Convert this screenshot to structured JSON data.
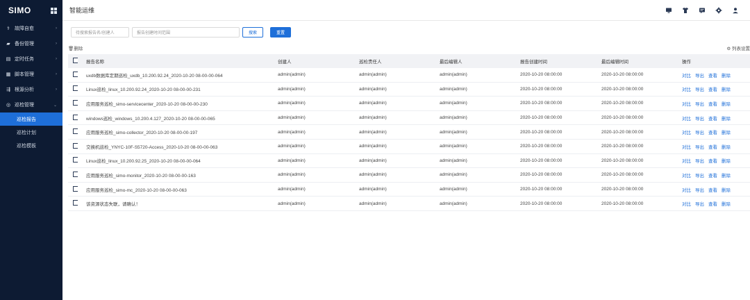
{
  "sidebar": {
    "logo": "SIMO",
    "menu": [
      {
        "label": "故障自愈",
        "icon": "fault-heal-icon",
        "glyph": "⚕"
      },
      {
        "label": "备份管理",
        "icon": "folder-icon",
        "glyph": "▰"
      },
      {
        "label": "定时任务",
        "icon": "schedule-icon",
        "glyph": "▤"
      },
      {
        "label": "脚本管理",
        "icon": "script-icon",
        "glyph": "▦"
      },
      {
        "label": "根源分析",
        "icon": "root-cause-icon",
        "glyph": "⇶"
      },
      {
        "label": "巡检管理",
        "icon": "inspection-icon",
        "glyph": "◎"
      }
    ],
    "submenu": [
      {
        "label": "巡检报告",
        "active": true
      },
      {
        "label": "巡检计划",
        "active": false
      },
      {
        "label": "巡检模板",
        "active": false
      }
    ]
  },
  "header": {
    "title": "智能运维"
  },
  "search": {
    "name_placeholder": "待搜索报告名/创建人",
    "date_placeholder": "报告创建时间范围",
    "search_label": "搜索",
    "reset_label": "重置"
  },
  "toolbar": {
    "delete_label": "删除",
    "columns_label": "列表设置"
  },
  "table": {
    "headers": [
      "报告名称",
      "创建人",
      "巡检责任人",
      "最后编辑人",
      "报告创建时间",
      "最后编辑时间",
      "操作"
    ],
    "ops": [
      "对比",
      "导出",
      "查看",
      "删除"
    ],
    "rows": [
      {
        "name": "uxdb数据库定期巡检_uxdb_10.200.92.24_2020-10-20 08-00-00-064",
        "creator": "admin(admin)",
        "owner": "admin(admin)",
        "editor": "admin(admin)",
        "created": "2020-10-20 08:00:00",
        "edited": "2020-10-20 08:00:00"
      },
      {
        "name": "Linux巡检_linux_10.200.92.24_2020-10-20 08-00-00-231",
        "creator": "admin(admin)",
        "owner": "admin(admin)",
        "editor": "admin(admin)",
        "created": "2020-10-20 08:00:00",
        "edited": "2020-10-20 08:00:00"
      },
      {
        "name": "应用服务巡检_simo-servicecenter_2020-10-20 08-00-00-230",
        "creator": "admin(admin)",
        "owner": "admin(admin)",
        "editor": "admin(admin)",
        "created": "2020-10-20 08:00:00",
        "edited": "2020-10-20 08:00:00"
      },
      {
        "name": "windows巡检_windows_10.200.4.127_2020-10-20 08-00-00-065",
        "creator": "admin(admin)",
        "owner": "admin(admin)",
        "editor": "admin(admin)",
        "created": "2020-10-20 08:00:00",
        "edited": "2020-10-20 08:00:00"
      },
      {
        "name": "应用服务巡检_simo-collector_2020-10-20 08-00-00-197",
        "creator": "admin(admin)",
        "owner": "admin(admin)",
        "editor": "admin(admin)",
        "created": "2020-10-20 08:00:00",
        "edited": "2020-10-20 08:00:00"
      },
      {
        "name": "交换机巡检_YNYC-10F-S5720-Access_2020-10-20 08-00-00-063",
        "creator": "admin(admin)",
        "owner": "admin(admin)",
        "editor": "admin(admin)",
        "created": "2020-10-20 08:00:00",
        "edited": "2020-10-20 08:00:00"
      },
      {
        "name": "Linux巡检_linux_10.200.92.25_2020-10-20 08-00-00-064",
        "creator": "admin(admin)",
        "owner": "admin(admin)",
        "editor": "admin(admin)",
        "created": "2020-10-20 08:00:00",
        "edited": "2020-10-20 08:00:00"
      },
      {
        "name": "应用服务巡检_simo-monitor_2020-10-20 08-00-00-163",
        "creator": "admin(admin)",
        "owner": "admin(admin)",
        "editor": "admin(admin)",
        "created": "2020-10-20 08:00:00",
        "edited": "2020-10-20 08:00:00"
      },
      {
        "name": "应用服务巡检_simo-mc_2020-10-20 08-00-00-063",
        "creator": "admin(admin)",
        "owner": "admin(admin)",
        "editor": "admin(admin)",
        "created": "2020-10-20 08:00:00",
        "edited": "2020-10-20 08:00:00"
      },
      {
        "name": "该资源状态失联，请确认！",
        "creator": "admin(admin)",
        "owner": "admin(admin)",
        "editor": "admin(admin)",
        "created": "2020-10-20 08:00:00",
        "edited": "2020-10-20 08:00:00"
      }
    ]
  },
  "colors": {
    "sidebar_bg": "#0d1b33",
    "accent": "#1e6fd9",
    "header_bg": "#f1f2f5"
  }
}
